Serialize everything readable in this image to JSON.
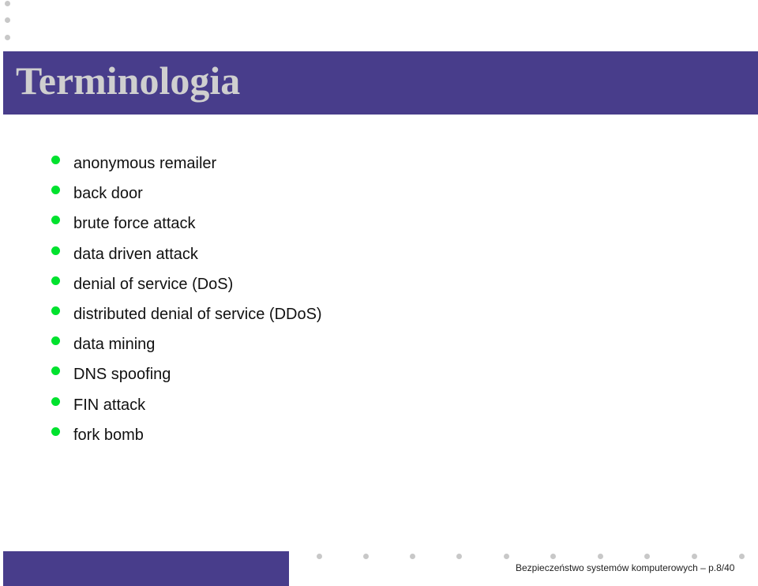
{
  "slide": {
    "title": "Terminologia",
    "items": [
      "anonymous remailer",
      "back door",
      "brute force attack",
      "data driven attack",
      "denial of service (DoS)",
      "distributed denial of service (DDoS)",
      "data mining",
      "DNS spoofing",
      "FIN attack",
      "fork bomb"
    ]
  },
  "footer": {
    "text": "Bezpieczeństwo systemów komputerowych – p.8/40",
    "course": "Bezpieczeństwo systemów komputerowych",
    "page": 8,
    "total_pages": 40
  },
  "colors": {
    "bar": "#483d8b",
    "title_text": "#cfcfcf",
    "bullet": "#00e22e",
    "nav_dot": "#c8c8c8"
  }
}
